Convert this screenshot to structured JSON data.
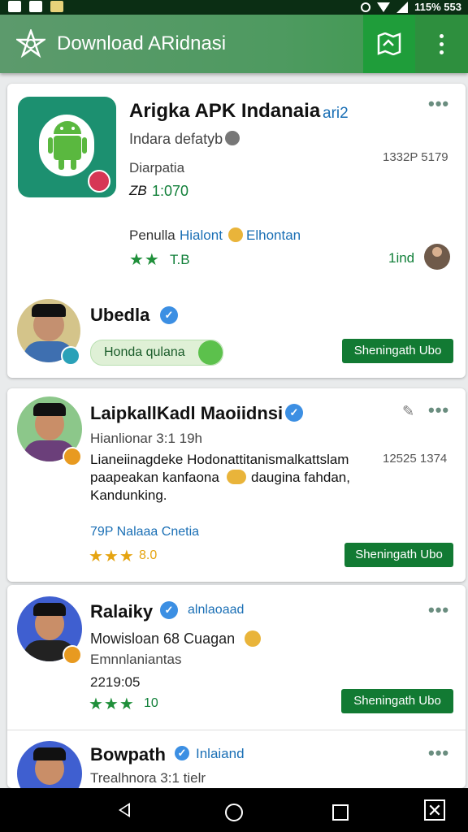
{
  "status": {
    "right_text": "115% 553"
  },
  "appbar": {
    "title": "Download ARidnasi"
  },
  "card1": {
    "app_title": "Arigka APK Indanaia",
    "app_title_suffix": "ari2",
    "developer": "Indara defatyb",
    "meta_number": "1332P 5179",
    "category": "Diarpatia",
    "version": "1:070",
    "version_prefix": "ZB",
    "review_label": "Penulla",
    "review_link1": "Hialont",
    "review_link2": "Elhontan",
    "rating_text": "T.B",
    "side_count": "1ind",
    "user_name": "Ubedla",
    "toggle_label": "Honda qulana",
    "button_label": "Sheningath Ubo"
  },
  "card2": {
    "user_name": "LaipkallKadl Maoiidnsi",
    "subtitle": "Hianlionar 3:1 19h",
    "meta_number": "12525 1374",
    "desc_line1": "Lianeiinagdeke Hodonattitanismalkattslam",
    "desc_line2": "paapeakan kanfaona",
    "desc_line2b": "daugina fahdan,",
    "desc_line3": "Kandunking.",
    "link_text": "79P Nalaaa Cnetia",
    "rating_text": "8.0",
    "button_label": "Sheningath Ubo"
  },
  "card3": {
    "user_name": "Ralaiky",
    "user_tag": "alnlaoaad",
    "line1": "Mowisloan 68 Cuagan",
    "line2": "Emnnlaniantas",
    "date": "2219:05",
    "rating_text": "10",
    "button_label": "Sheningath Ubo",
    "user2_name": "Bowpath",
    "user2_tag": "Inlaiand",
    "user2_sub": "Trealhnora 3:1 tielr"
  },
  "colors": {
    "brand_green": "#127a33",
    "appbar": "#4e9a60",
    "link_blue": "#1a6fb5"
  }
}
